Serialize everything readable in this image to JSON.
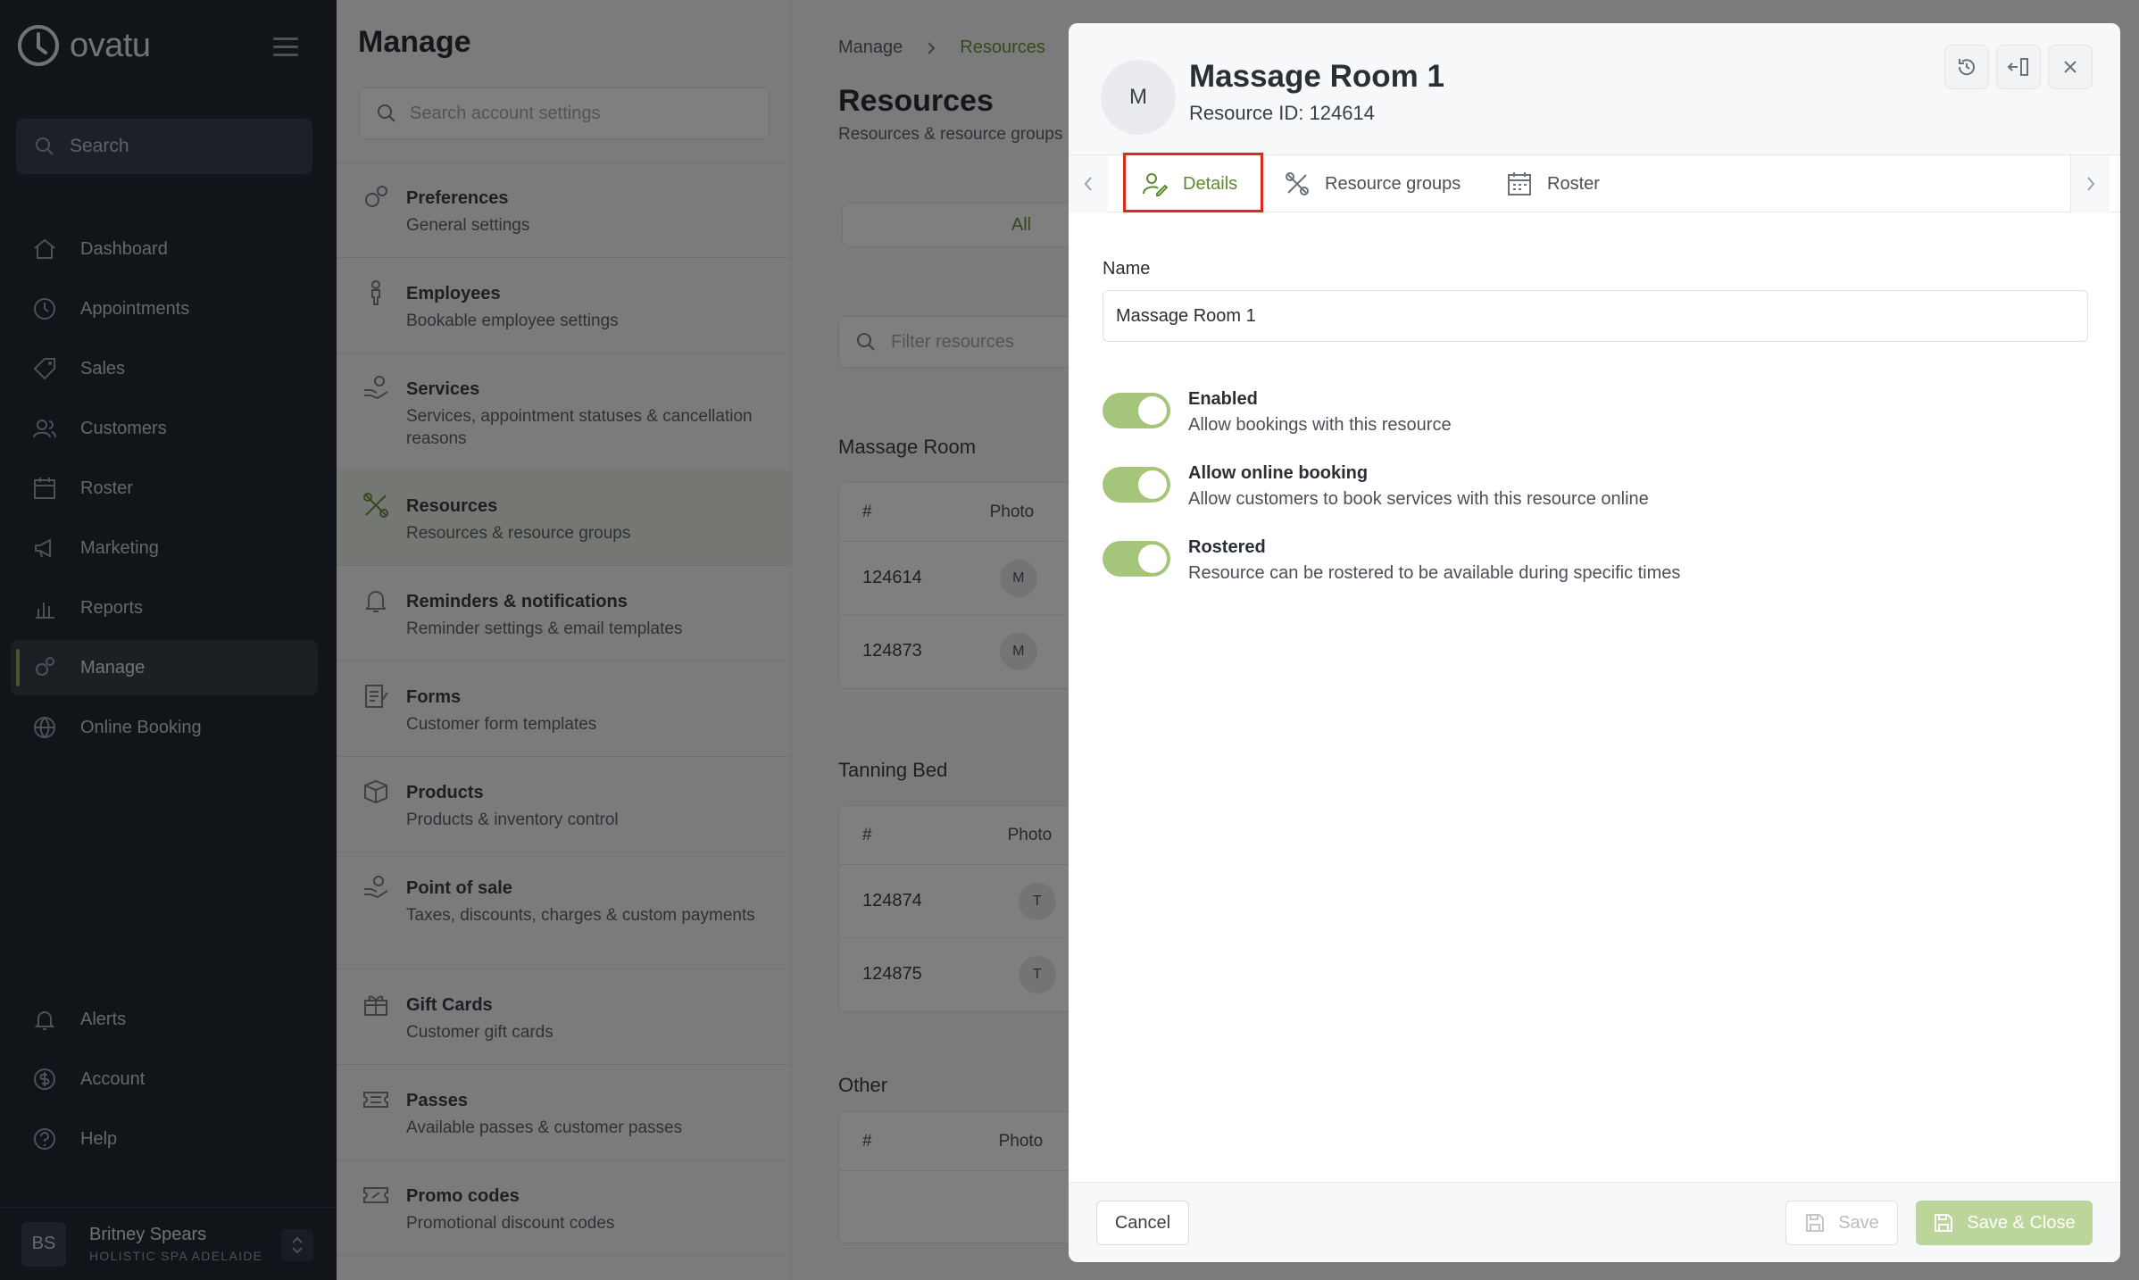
{
  "brand": {
    "name": "ovatu"
  },
  "nav": {
    "search_label": "Search",
    "items": [
      {
        "label": "Dashboard"
      },
      {
        "label": "Appointments"
      },
      {
        "label": "Sales"
      },
      {
        "label": "Customers"
      },
      {
        "label": "Roster"
      },
      {
        "label": "Marketing"
      },
      {
        "label": "Reports"
      },
      {
        "label": "Manage"
      },
      {
        "label": "Online Booking"
      },
      {
        "label": "Alerts"
      },
      {
        "label": "Account"
      },
      {
        "label": "Help"
      }
    ],
    "active": "Manage",
    "accent_color": "#8cb15a"
  },
  "user": {
    "initials": "BS",
    "name": "Britney Spears",
    "org": "HOLISTIC SPA ADELAIDE"
  },
  "manage": {
    "title": "Manage",
    "search_placeholder": "Search account settings",
    "items": [
      {
        "title": "Preferences",
        "subtitle": "General settings"
      },
      {
        "title": "Employees",
        "subtitle": "Bookable employee settings"
      },
      {
        "title": "Services",
        "subtitle": "Services, appointment statuses & cancellation reasons"
      },
      {
        "title": "Resources",
        "subtitle": "Resources & resource groups"
      },
      {
        "title": "Reminders & notifications",
        "subtitle": "Reminder settings & email templates"
      },
      {
        "title": "Forms",
        "subtitle": "Customer form templates"
      },
      {
        "title": "Products",
        "subtitle": "Products & inventory control"
      },
      {
        "title": "Point of sale",
        "subtitle": "Taxes, discounts, charges & custom payments"
      },
      {
        "title": "Gift Cards",
        "subtitle": "Customer gift cards"
      },
      {
        "title": "Passes",
        "subtitle": "Available passes & customer passes"
      },
      {
        "title": "Promo codes",
        "subtitle": "Promotional discount codes"
      }
    ]
  },
  "resources": {
    "breadcrumb": [
      "Manage",
      "Resources"
    ],
    "title": "Resources",
    "subtitle": "Resources & resource groups",
    "segment_all": "All",
    "filter_placeholder": "Filter resources",
    "col_number": "#",
    "col_photo": "Photo",
    "groups": [
      {
        "name": "Massage Room",
        "rows": [
          {
            "id": "124614",
            "initial": "M"
          },
          {
            "id": "124873",
            "initial": "M"
          }
        ]
      },
      {
        "name": "Tanning Bed",
        "rows": [
          {
            "id": "124874",
            "initial": "T"
          },
          {
            "id": "124875",
            "initial": "T"
          }
        ]
      },
      {
        "name": "Other",
        "rows": []
      }
    ]
  },
  "dialog": {
    "avatar_initial": "M",
    "title": "Massage Room 1",
    "resource_id": "Resource ID: 124614",
    "tabs": [
      {
        "label": "Details"
      },
      {
        "label": "Resource groups"
      },
      {
        "label": "Roster"
      }
    ],
    "active_tab": "Details",
    "name_label": "Name",
    "name_value": "Massage Room 1",
    "toggles": [
      {
        "title": "Enabled",
        "subtitle": "Allow bookings with this resource",
        "on": true
      },
      {
        "title": "Allow online booking",
        "subtitle": "Allow customers to book services with this resource online",
        "on": true
      },
      {
        "title": "Rostered",
        "subtitle": "Resource can be rostered to be available during specific times",
        "on": true
      }
    ],
    "cancel_label": "Cancel",
    "save_label": "Save",
    "save_close_label": "Save & Close"
  }
}
